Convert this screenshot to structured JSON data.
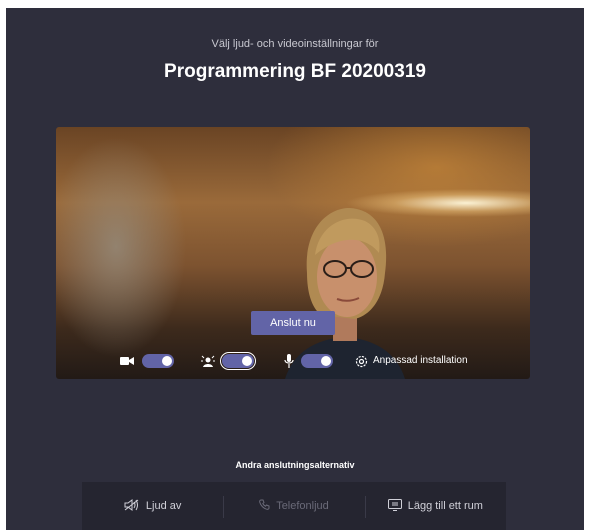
{
  "header": {
    "subtitle": "Välj ljud- och videoinställningar för",
    "title": "Programmering BF 20200319"
  },
  "preview": {
    "join_label": "Anslut nu"
  },
  "controls": {
    "camera": {
      "icon": "camera-icon",
      "enabled": true
    },
    "background_blur": {
      "icon": "background-blur-icon",
      "enabled": true
    },
    "microphone": {
      "icon": "microphone-icon",
      "enabled": true
    },
    "settings": {
      "icon": "gear-icon",
      "label": "Anpassad installation"
    }
  },
  "other_options": {
    "heading": "Andra anslutningsalternativ",
    "items": [
      {
        "icon": "speaker-off-icon",
        "label": "Ljud av",
        "enabled": true
      },
      {
        "icon": "phone-icon",
        "label": "Telefonljud",
        "enabled": false
      },
      {
        "icon": "room-icon",
        "label": "Lägg till ett rum",
        "enabled": true
      }
    ]
  },
  "colors": {
    "background": "#2e2e3c",
    "accent": "#6264a7",
    "options_bar": "#252530"
  }
}
